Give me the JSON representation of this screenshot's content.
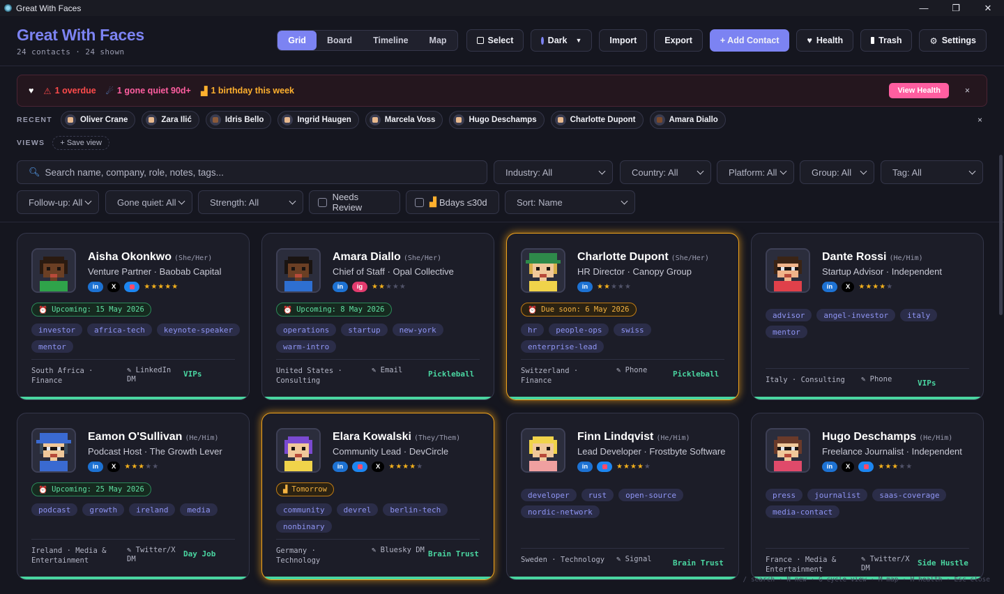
{
  "window": {
    "title": "Great With Faces",
    "controls": [
      "—",
      "❐",
      "✕"
    ]
  },
  "header": {
    "title": "Great With Faces",
    "subtitle": "24 contacts · 24 shown",
    "view_tabs": [
      "Grid",
      "Board",
      "Timeline",
      "Map"
    ],
    "active_tab": "Grid",
    "select_label": "Select",
    "theme_label": "Dark",
    "import_label": "Import",
    "export_label": "Export",
    "add_label": "+ Add Contact",
    "health_label": "Health",
    "trash_label": "Trash",
    "settings_label": "Settings"
  },
  "alert": {
    "overdue": "1 overdue",
    "quiet": "1 gone quiet 90d+",
    "birthday": "1 birthday this week",
    "view_health": "View Health",
    "close": "×"
  },
  "recent": {
    "label": "RECENT",
    "items": [
      "Oliver Crane",
      "Zara Ilić",
      "Idris Bello",
      "Ingrid Haugen",
      "Marcela Voss",
      "Hugo Deschamps",
      "Charlotte Dupont",
      "Amara Diallo"
    ],
    "close": "×"
  },
  "views": {
    "label": "VIEWS",
    "save": "+ Save view"
  },
  "filters": {
    "search_placeholder": "Search name, company, role, notes, tags...",
    "industry": "Industry: All",
    "country": "Country: All",
    "platform": "Platform: All",
    "group": "Group: All",
    "tag": "Tag: All",
    "followup": "Follow-up: All",
    "quiet": "Gone quiet: All",
    "strength": "Strength: All",
    "needs_review": "Needs Review",
    "bdays": "Bdays ≤30d",
    "sort": "Sort: Name"
  },
  "cards": [
    {
      "name": "Aisha Okonkwo",
      "pronouns": "(She/Her)",
      "role": "Venture Partner · Baobab Capital",
      "socials": [
        "in",
        "x",
        "bs"
      ],
      "stars": 5,
      "due": "Upcoming: 15 May 2026",
      "due_type": "green",
      "tags": [
        "investor",
        "africa-tech",
        "keynote-speaker",
        "mentor"
      ],
      "location": "South Africa · Finance",
      "channel": "LinkedIn DM",
      "group": "VIPs",
      "glow": false
    },
    {
      "name": "Amara Diallo",
      "pronouns": "(She/Her)",
      "role": "Chief of Staff · Opal Collective",
      "socials": [
        "in",
        "ig"
      ],
      "stars": 2,
      "due": "Upcoming: 8 May 2026",
      "due_type": "green",
      "tags": [
        "operations",
        "startup",
        "new-york",
        "warm-intro"
      ],
      "location": "United States · Consulting",
      "channel": "Email",
      "group": "Pickleball",
      "glow": false
    },
    {
      "name": "Charlotte Dupont",
      "pronouns": "(She/Her)",
      "role": "HR Director · Canopy Group",
      "socials": [
        "in"
      ],
      "stars": 2,
      "due": "Due soon: 6 May 2026",
      "due_type": "amber",
      "tags": [
        "hr",
        "people-ops",
        "swiss",
        "enterprise-lead"
      ],
      "location": "Switzerland · Finance",
      "channel": "Phone",
      "group": "Pickleball",
      "glow": true
    },
    {
      "name": "Dante Rossi",
      "pronouns": "(He/Him)",
      "role": "Startup Advisor · Independent",
      "socials": [
        "in",
        "x"
      ],
      "stars": 4,
      "due": "",
      "due_type": "",
      "tags": [
        "advisor",
        "angel-investor",
        "italy",
        "mentor"
      ],
      "location": "Italy · Consulting",
      "channel": "Phone",
      "group": "VIPs",
      "glow": false
    },
    {
      "name": "Eamon O'Sullivan",
      "pronouns": "(He/Him)",
      "role": "Podcast Host · The Growth Lever",
      "socials": [
        "in",
        "x"
      ],
      "stars": 3,
      "due": "Upcoming: 25 May 2026",
      "due_type": "green",
      "tags": [
        "podcast",
        "growth",
        "ireland",
        "media"
      ],
      "location": "Ireland · Media & Entertainment",
      "channel": "Twitter/X DM",
      "group": "Day Job",
      "glow": false
    },
    {
      "name": "Elara Kowalski",
      "pronouns": "(They/Them)",
      "role": "Community Lead · DevCircle",
      "socials": [
        "in",
        "bs",
        "x"
      ],
      "stars": 4,
      "due": "Tomorrow",
      "due_type": "amber",
      "tags": [
        "community",
        "devrel",
        "berlin-tech",
        "nonbinary"
      ],
      "location": "Germany · Technology",
      "channel": "Bluesky DM",
      "group": "Brain Trust",
      "glow": true
    },
    {
      "name": "Finn Lindqvist",
      "pronouns": "(He/Him)",
      "role": "Lead Developer · Frostbyte Software",
      "socials": [
        "in",
        "bs"
      ],
      "stars": 4,
      "due": "",
      "due_type": "",
      "tags": [
        "developer",
        "rust",
        "open-source",
        "nordic-network"
      ],
      "location": "Sweden · Technology",
      "channel": "Signal",
      "group": "Brain Trust",
      "glow": false
    },
    {
      "name": "Hugo Deschamps",
      "pronouns": "(He/Him)",
      "role": "Freelance Journalist · Independent",
      "socials": [
        "in",
        "x",
        "bs"
      ],
      "stars": 3,
      "due": "",
      "due_type": "",
      "tags": [
        "press",
        "journalist",
        "saas-coverage",
        "media-contact"
      ],
      "location": "France · Media & Entertainment",
      "channel": "Twitter/X DM",
      "group": "Side Hustle",
      "glow": false
    }
  ],
  "hints": "/ search · N new · G cycle view · M map · H health · Esc close",
  "colors": {
    "accent": "#7c83f2",
    "success": "#4ad6a1",
    "warning": "#f0a31c",
    "danger": "#ff4b4b"
  }
}
